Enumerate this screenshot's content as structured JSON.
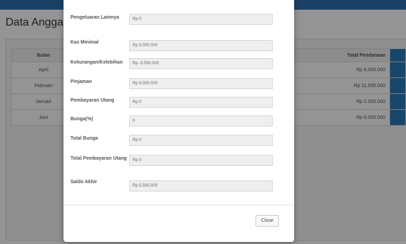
{
  "background": {
    "page_title": "Data Anggaran",
    "table": {
      "headers": [
        "Bulan",
        "Total Pendanaan"
      ],
      "rows": [
        {
          "bulan": "April",
          "total": "Rp 6.000.000"
        },
        {
          "bulan": "Februari",
          "total": "Rp 11.500.000"
        },
        {
          "bulan": "Januari",
          "total": "Rp 2.000.000"
        },
        {
          "bulan": "Juni",
          "total": "Rp 6.000.000"
        }
      ]
    }
  },
  "modal": {
    "fields": [
      {
        "label": "Pengeluaran Lainnya",
        "value": "Rp 0"
      },
      {
        "label": "Kas Minimal",
        "value": "Rp 5.000.000"
      },
      {
        "label": "Kekurangan/Kelebihan",
        "value": "Rp -5.500.000"
      },
      {
        "label": "Pinjaman",
        "value": "Rp 6.000.000"
      },
      {
        "label": "Pembayaran Utang",
        "value": "Rp 0"
      },
      {
        "label": "Bunga(%)",
        "value": "0"
      },
      {
        "label": "Total Bunga",
        "value": "Rp 0"
      },
      {
        "label": "Total Pembayaran Utang",
        "value": "Rp 0"
      },
      {
        "label": "Saldo Akhir",
        "value": "Rp 5.500.000"
      }
    ],
    "close_label": "Close"
  }
}
